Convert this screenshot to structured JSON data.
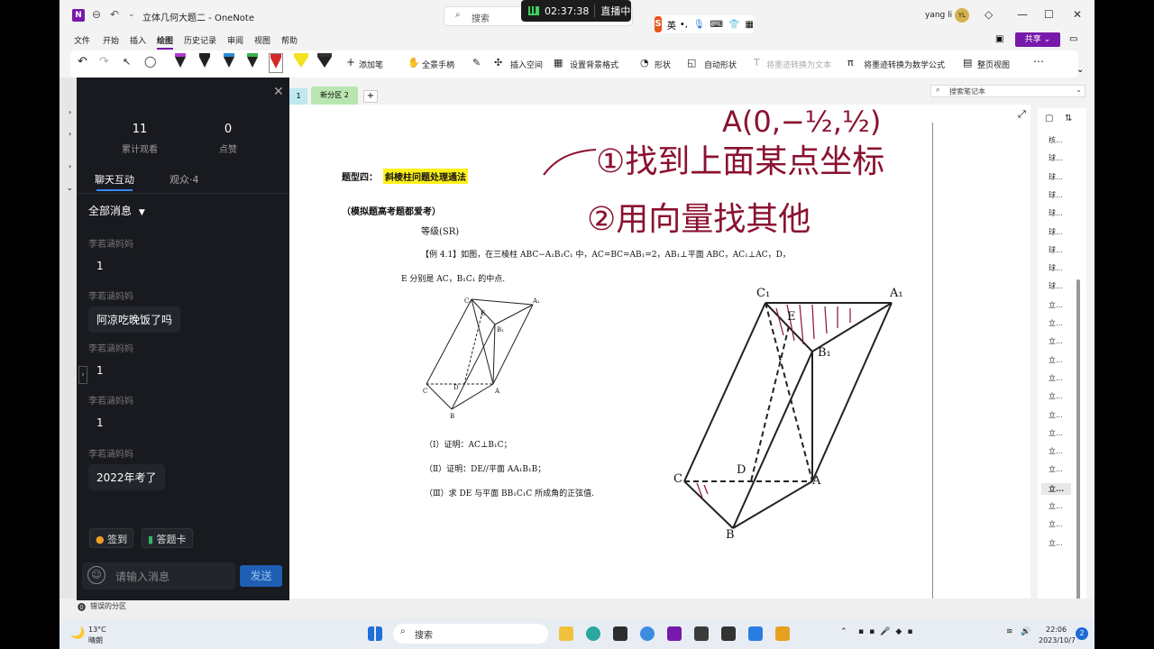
{
  "window": {
    "title": "立体几何大题二 - OneNote",
    "search_placeholder": "搜索",
    "user_name": "yang li",
    "user_initials": "YL"
  },
  "live": {
    "time": "02:37:38",
    "status": "直播中"
  },
  "ime": {
    "label": "英"
  },
  "menu": [
    "文件",
    "开始",
    "插入",
    "绘图",
    "历史记录",
    "审阅",
    "视图",
    "帮助"
  ],
  "share_label": "共享",
  "ribbon": {
    "add_pen": "添加笔",
    "full_hand": "全景手柄",
    "insert_space": "插入空间",
    "bg_format": "设置背景格式",
    "shapes": "形状",
    "auto_shapes": "自动形状",
    "ink_to_text": "将墨迹转换为文本",
    "ink_to_math": "将墨迹转换为数学公式",
    "page_view": "整页视图"
  },
  "tabs": {
    "first": "1",
    "new_section": "新分区 2",
    "add": "+"
  },
  "notebook_search": "搜索笔记本",
  "page_list": [
    "核...",
    "球...",
    "球...",
    "球...",
    "球...",
    "球...",
    "球...",
    "球...",
    "球...",
    "立...",
    "立...",
    "立...",
    "立...",
    "立...",
    "立...",
    "立...",
    "立...",
    "立...",
    "立...",
    "立...",
    "立...",
    "立...",
    "立..."
  ],
  "status_bar": "错误的分区",
  "chat": {
    "views_count": "11",
    "views_label": "累计观看",
    "likes_count": "0",
    "likes_label": "点赞",
    "tab_chat": "聊天互动",
    "tab_audience": "观众·4",
    "filter": "全部消息",
    "messages": [
      {
        "user": "李若涵妈妈",
        "text": "1"
      },
      {
        "user": "李若涵妈妈",
        "text": "阿凉吃晚饭了吗"
      },
      {
        "user": "李若涵妈妈",
        "text": "1"
      },
      {
        "user": "李若涵妈妈",
        "text": "1"
      },
      {
        "user": "李若涵妈妈",
        "text": "2022年考了"
      }
    ],
    "checkin": "签到",
    "answer_card": "答题卡",
    "input_placeholder": "请输入消息",
    "send": "发送"
  },
  "page": {
    "heading_prefix": "题型四：",
    "heading_highlight": "斜棱柱问题处理通法",
    "subheading": "（模拟题高考题都爱考）",
    "grade": "等级(SR)",
    "example_line1": "【例 4.1】如图，在三棱柱 ABC−A₁B₁C₁ 中，AC=BC=AB₁=2，AB₁⊥平面 ABC，AC₁⊥AC，D，",
    "example_line2": "E 分别是 AC，B₁C₁ 的中点.",
    "q1": "（Ⅰ）证明：AC⊥B₁C；",
    "q2": "（Ⅱ）证明：DE//平面 AA₁B₁B；",
    "q3": "（Ⅲ）求 DE 与平面 BB₁C₁C 所成角的正弦值.",
    "handwriting": {
      "top": "A(0,−½,½)",
      "step1": "①找到上面某点坐标",
      "step2": "②用向量找其他"
    },
    "labels": {
      "C1": "C₁",
      "A1": "A₁",
      "B1": "B₁",
      "E": "E",
      "D": "D",
      "C": "C",
      "A": "A",
      "B": "B"
    }
  },
  "taskbar": {
    "temp": "13°C",
    "condition": "晴朗",
    "search": "搜索",
    "time": "22:06",
    "date": "2023/10/7",
    "notifications": "2"
  }
}
